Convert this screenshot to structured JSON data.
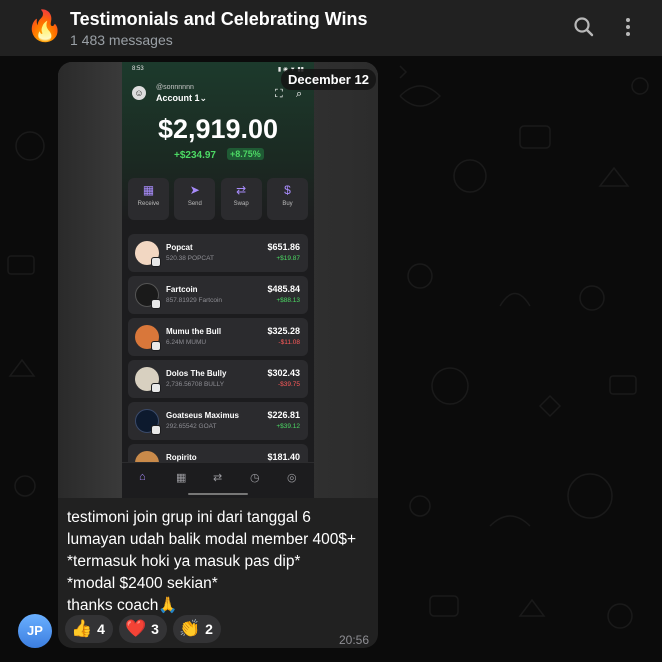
{
  "header": {
    "channel_emoji": "🔥",
    "title": "Testimonials and Celebrating Wins",
    "subtitle": "1 483 messages",
    "icons": [
      "search-icon",
      "more-vertical-icon"
    ]
  },
  "message": {
    "date_label": "December 12",
    "sender_initials": "JP",
    "time": "20:56",
    "caption_lines": [
      "testimoni join grup ini dari tanggal 6",
      "lumayan udah balik modal member 400$+",
      "*termasuk hoki ya masuk pas dip*",
      "*modal $2400 sekian*",
      "thanks coach🙏"
    ],
    "reactions": [
      {
        "emoji": "👍",
        "count": "4"
      },
      {
        "emoji": "❤️",
        "count": "3"
      },
      {
        "emoji": "👏",
        "count": "2"
      }
    ]
  },
  "screenshot": {
    "status_time": "8:53",
    "handle": "@sonnnnnn",
    "account": "Account 1",
    "balance": "$2,919.00",
    "change": "+$234.97",
    "change_pct": "+8.75%",
    "actions": [
      {
        "label": "Receive",
        "icon": "qr-icon"
      },
      {
        "label": "Send",
        "icon": "send-icon"
      },
      {
        "label": "Swap",
        "icon": "swap-icon"
      },
      {
        "label": "Buy",
        "icon": "dollar-icon"
      }
    ],
    "tokens": [
      {
        "name": "Popcat",
        "amount": "520.38 POPCAT",
        "value": "$651.86",
        "change": "+$19.87",
        "up": true,
        "color": "#f2d7c2"
      },
      {
        "name": "Fartcoin",
        "amount": "857.81929 Fartcoin",
        "value": "$485.84",
        "change": "+$88.13",
        "up": true,
        "color": "#1a1a1a"
      },
      {
        "name": "Mumu the Bull",
        "amount": "6.24M MUMU",
        "value": "$325.28",
        "change": "-$11.08",
        "up": false,
        "color": "#d9773a"
      },
      {
        "name": "Dolos The Bully",
        "amount": "2,736.56708 BULLY",
        "value": "$302.43",
        "change": "-$39.75",
        "up": false,
        "color": "#d8d0c0"
      },
      {
        "name": "Goatseus Maximus",
        "amount": "292.65542 GOAT",
        "value": "$226.81",
        "change": "+$39.12",
        "up": true,
        "color": "#0d1a2e"
      },
      {
        "name": "Ropirito",
        "amount": "",
        "value": "$181.40",
        "change": "",
        "up": true,
        "color": "#c98a4a"
      }
    ],
    "colors": {
      "positive": "#4cd964",
      "negative": "#ff5a5a",
      "accent": "#a78bfa"
    }
  }
}
